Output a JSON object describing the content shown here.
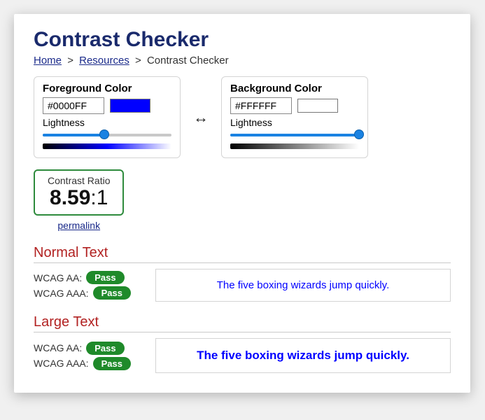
{
  "title": "Contrast Checker",
  "breadcrumb": {
    "home": "Home",
    "resources": "Resources",
    "current": "Contrast Checker",
    "sep": ">"
  },
  "foreground": {
    "title": "Foreground Color",
    "hex": "#0000FF",
    "swatch": "#0000FF",
    "lightness_label": "Lightness",
    "slider_pct": 48,
    "gradient_css": "linear-gradient(to right,#000,#0000FF,#fff)"
  },
  "background": {
    "title": "Background Color",
    "hex": "#FFFFFF",
    "swatch": "#FFFFFF",
    "lightness_label": "Lightness",
    "slider_pct": 100,
    "gradient_css": "linear-gradient(to right,#000,#fff)"
  },
  "swap_glyph": "↔",
  "ratio": {
    "title": "Contrast Ratio",
    "value": "8.59",
    "suffix": ":1"
  },
  "permalink": "permalink",
  "normal": {
    "heading": "Normal Text",
    "aa_label": "WCAG AA:",
    "aa_status": "Pass",
    "aaa_label": "WCAG AAA:",
    "aaa_status": "Pass",
    "sample": "The five boxing wizards jump quickly."
  },
  "large": {
    "heading": "Large Text",
    "aa_label": "WCAG AA:",
    "aa_status": "Pass",
    "aaa_label": "WCAG AAA:",
    "aaa_status": "Pass",
    "sample": "The five boxing wizards jump quickly."
  }
}
